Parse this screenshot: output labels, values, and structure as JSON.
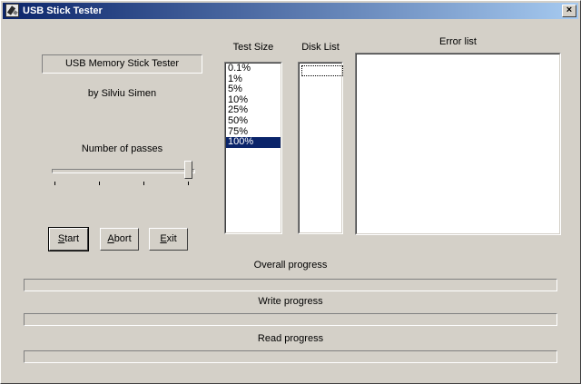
{
  "window": {
    "title": "USB Stick Tester",
    "close_label": "×"
  },
  "app": {
    "heading": "USB Memory Stick Tester",
    "author": "by Silviu Simen"
  },
  "passes": {
    "label": "Number of passes",
    "value_fraction": 1.0
  },
  "buttons": {
    "start": {
      "underline": "S",
      "rest": "tart"
    },
    "abort": {
      "underline": "A",
      "rest": "bort"
    },
    "exit": {
      "underline": "E",
      "rest": "xit"
    }
  },
  "test_size": {
    "label": "Test Size",
    "items": [
      "0.1%",
      "1%",
      "5%",
      "10%",
      "25%",
      "50%",
      "75%",
      "100%"
    ],
    "selected": "100%"
  },
  "disk_list": {
    "label": "Disk List",
    "items": []
  },
  "error_list": {
    "label": "Error list",
    "items": []
  },
  "progress": {
    "overall": {
      "label": "Overall progress",
      "value": 0
    },
    "write": {
      "label": "Write progress",
      "value": 0
    },
    "read": {
      "label": "Read progress",
      "value": 0
    }
  }
}
